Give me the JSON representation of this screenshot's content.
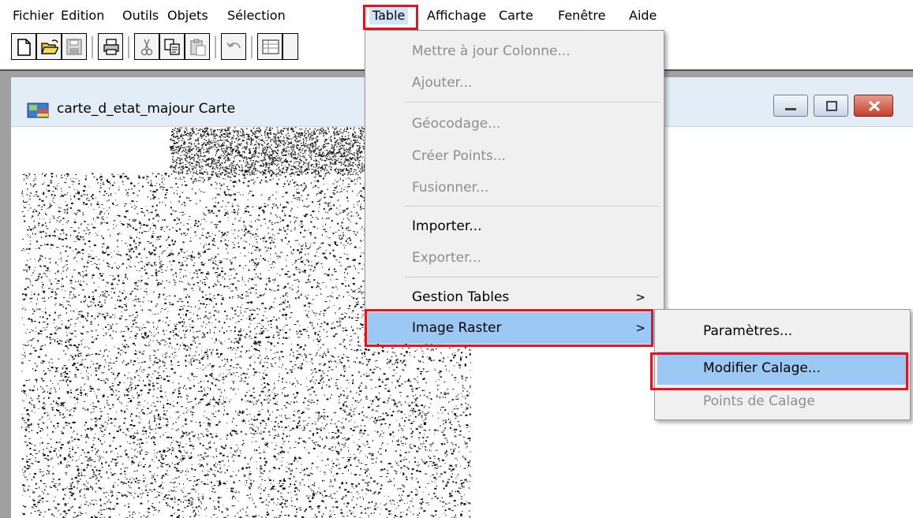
{
  "menubar": {
    "items": [
      "Fichier",
      "Edition",
      "Outils",
      "Objets",
      "Sélection",
      "Table",
      "Affichage",
      "Carte",
      "Fenêtre",
      "Aide"
    ]
  },
  "toolbar": {
    "buttons": [
      "new-document-icon",
      "open-folder-icon",
      "save-icon",
      "print-icon",
      "cut-icon",
      "copy-icon",
      "paste-icon",
      "undo-icon",
      "table-view-icon"
    ]
  },
  "map_window": {
    "title": "carte_d_etat_majour Carte"
  },
  "table_menu": {
    "items": [
      {
        "label": "Mettre à jour Colonne...",
        "enabled": false
      },
      {
        "label": "Ajouter...",
        "enabled": false
      },
      {
        "label": "Géocodage...",
        "enabled": false
      },
      {
        "label": "Créer Points...",
        "enabled": false
      },
      {
        "label": "Fusionner...",
        "enabled": false
      },
      {
        "label": "Importer...",
        "enabled": true
      },
      {
        "label": "Exporter...",
        "enabled": false
      },
      {
        "label": "Gestion Tables",
        "enabled": true,
        "submenu": true
      },
      {
        "label": "Image Raster",
        "enabled": true,
        "submenu": true,
        "highlighted": true
      }
    ],
    "submenu_arrow": ">"
  },
  "raster_submenu": {
    "items": [
      {
        "label": "Paramètres...",
        "enabled": true
      },
      {
        "label": "Modifier Calage...",
        "enabled": true,
        "highlighted": true
      },
      {
        "label": "Points de Calage",
        "enabled": false
      }
    ]
  },
  "colors": {
    "highlight_box": "#e8141c",
    "menu_highlight": "#9cc9f4",
    "menu_background": "#f0f0f0",
    "disabled_text": "#8d8d8d"
  }
}
